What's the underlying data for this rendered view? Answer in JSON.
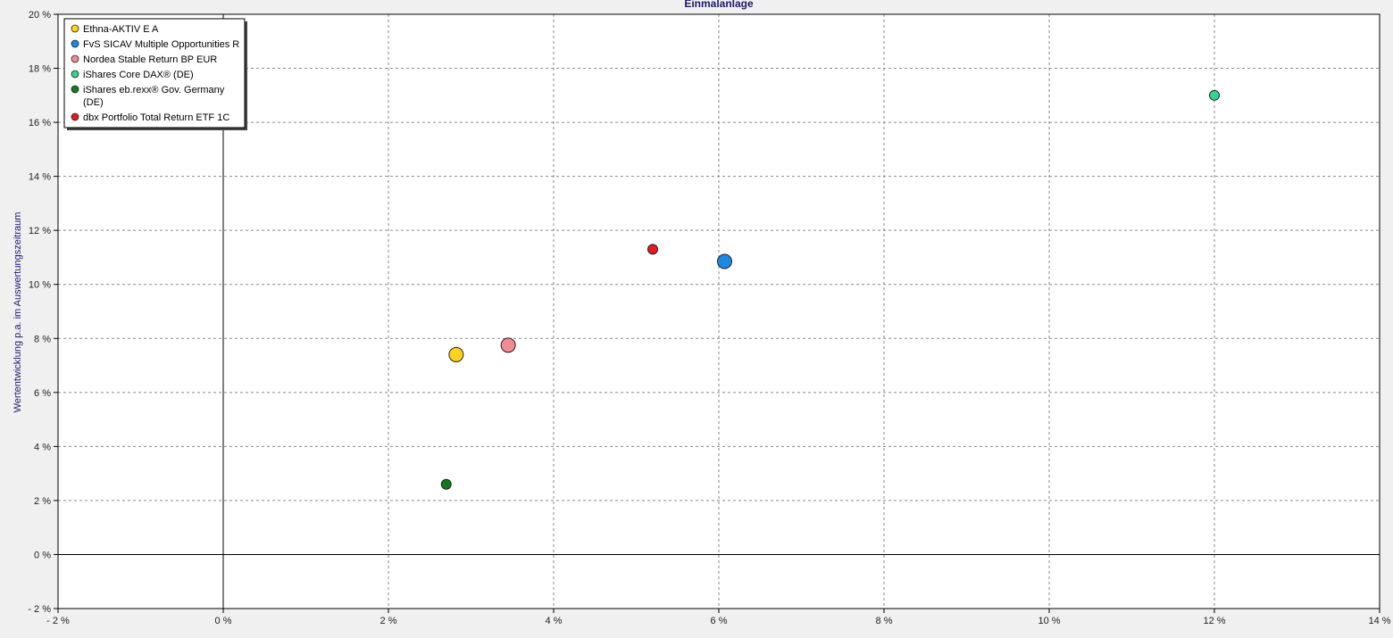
{
  "chart_data": {
    "type": "scatter",
    "title": "Einmalanlage",
    "xlabel": "",
    "ylabel": "Wertentwicklung p.a. im Auswertungszeitraum",
    "xlim": [
      -2,
      14
    ],
    "ylim": [
      -2,
      20
    ],
    "x_ticks": [
      -2,
      0,
      2,
      4,
      6,
      8,
      10,
      12,
      14
    ],
    "y_ticks": [
      -2,
      0,
      2,
      4,
      6,
      8,
      10,
      12,
      14,
      16,
      18,
      20
    ],
    "x_tick_labels": [
      "- 2 %",
      "0 %",
      "2 %",
      "4 %",
      "6 %",
      "8 %",
      "10 %",
      "12 %",
      "14 %"
    ],
    "y_tick_labels": [
      "- 2 %",
      "0 %",
      "2 %",
      "4 %",
      "6 %",
      "8 %",
      "10 %",
      "12 %",
      "14 %",
      "16 %",
      "18 %",
      "20 %"
    ],
    "grid": true,
    "legend_position": "top-left",
    "series": [
      {
        "name": "Ethna-AKTIV E A",
        "color": "#ffd21f",
        "x": 2.82,
        "y": 7.4,
        "size": "large"
      },
      {
        "name": "FvS SICAV Multiple Opportunities R",
        "color": "#1e88e5",
        "x": 6.07,
        "y": 10.85,
        "size": "large"
      },
      {
        "name": "Nordea Stable Return BP EUR",
        "color": "#f28b92",
        "x": 3.45,
        "y": 7.75,
        "size": "large"
      },
      {
        "name": "iShares Core DAX® (DE)",
        "color": "#33d58f",
        "x": 12.0,
        "y": 17.0,
        "size": "small"
      },
      {
        "name": "iShares eb.rexx® Gov. Germany (DE)",
        "color": "#147a1c",
        "x": 2.7,
        "y": 2.6,
        "size": "small"
      },
      {
        "name": "dbx Portfolio Total Return ETF 1C",
        "color": "#e21b23",
        "x": 5.2,
        "y": 11.3,
        "size": "small"
      }
    ]
  }
}
